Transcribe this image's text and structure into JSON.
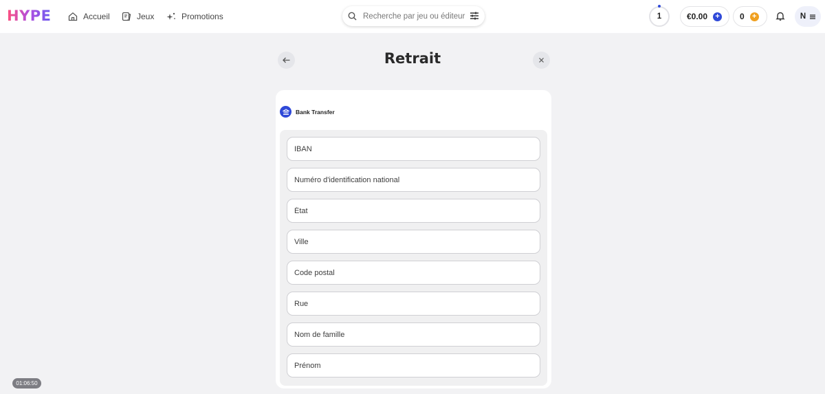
{
  "header": {
    "logo": "HYPE",
    "nav": [
      {
        "label": "Accueil",
        "icon": "home-icon"
      },
      {
        "label": "Jeux",
        "icon": "games-icon"
      },
      {
        "label": "Promotions",
        "icon": "sparkle-icon"
      }
    ],
    "search": {
      "placeholder": "Recherche par jeu ou éditeur",
      "value": ""
    },
    "level": "1",
    "balance": "€0.00",
    "coins": "0",
    "avatar_initial": "N"
  },
  "page": {
    "title": "Retrait",
    "back_icon": "arrow-left-icon",
    "close_icon": "close-icon"
  },
  "withdraw": {
    "method_label": "Bank Transfer",
    "method_icon": "bank-icon",
    "fields": [
      {
        "placeholder": "IBAN",
        "value": ""
      },
      {
        "placeholder": "Numéro d'identification national",
        "value": ""
      },
      {
        "placeholder": "État",
        "value": ""
      },
      {
        "placeholder": "Ville",
        "value": ""
      },
      {
        "placeholder": "Code postal",
        "value": ""
      },
      {
        "placeholder": "Rue",
        "value": ""
      },
      {
        "placeholder": "Nom de famille",
        "value": ""
      },
      {
        "placeholder": "Prénom",
        "value": ""
      }
    ]
  },
  "timer": "01:06:50",
  "colors": {
    "accent": "#2f49d8",
    "coin": "#f0a020",
    "background": "#f2f2f4"
  }
}
